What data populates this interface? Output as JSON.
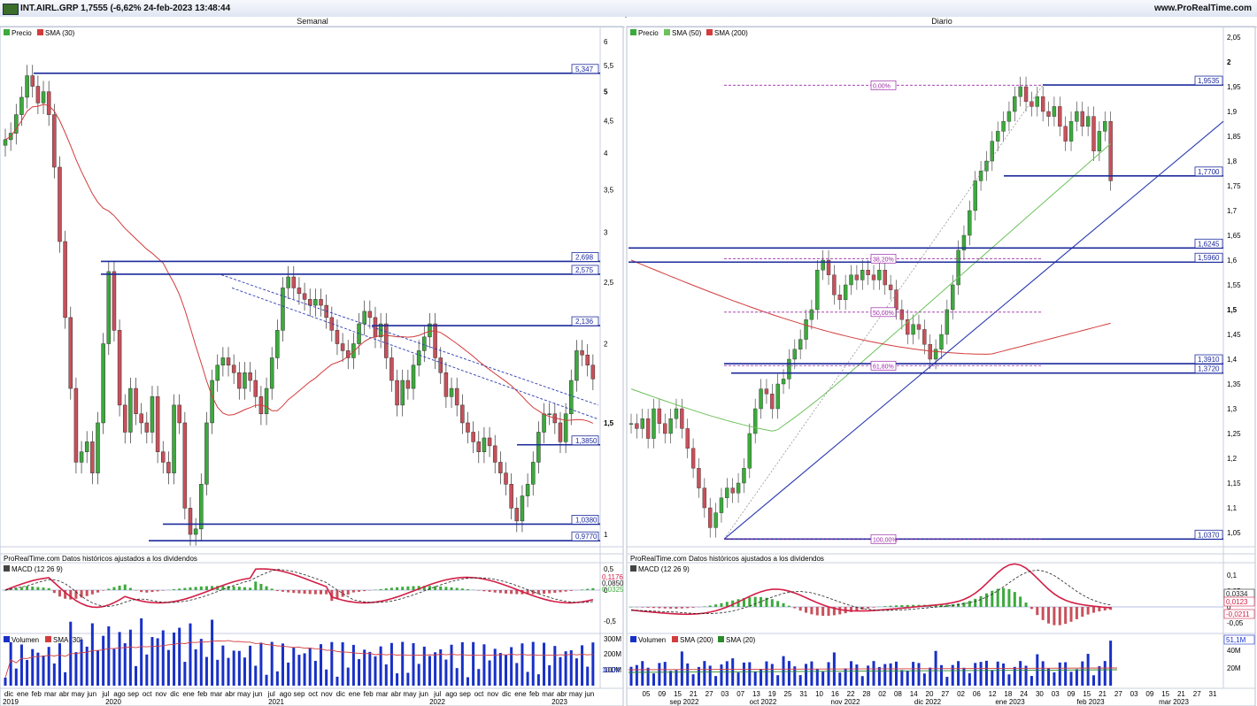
{
  "header": {
    "ticker": "INT.AIRL.GRP 1,7555 (-6,62% 24-feb-2023 13:48:44",
    "site": "www.ProRealTime.com"
  },
  "colors": {
    "up": "#3caa3c",
    "down": "#c8505a",
    "sma_red": "#d23c3c",
    "sma_green": "#6cc25a",
    "level": "#1c2a9c",
    "fib": "#9c2aa6",
    "macd": "#d21e46",
    "signal": "#222222",
    "volume": "#1830c8"
  },
  "weekly": {
    "title": "Semanal",
    "legend": {
      "price": "Precio",
      "sma": "SMA (30)"
    },
    "yticks": [
      "6",
      "5,5",
      "5",
      "4,5",
      "4",
      "3,5",
      "3",
      "2,5",
      "2",
      "1,5",
      "1"
    ],
    "levels": [
      {
        "label": "5,347",
        "value": 5.347
      },
      {
        "label": "2,698",
        "value": 2.698
      },
      {
        "label": "2,575",
        "value": 2.575
      },
      {
        "label": "2,136",
        "value": 2.136
      },
      {
        "label": "1,3850",
        "value": 1.385
      },
      {
        "label": "1,0380",
        "value": 1.038
      },
      {
        "label": "0,9770",
        "value": 0.977
      }
    ],
    "footer": "ProRealTime.com  Datos históricos ajustados a los dividendos",
    "macd": {
      "legend": "MACD (12 26 9)",
      "ticks": [
        "0,5",
        "0",
        "-0,5"
      ],
      "labels": [
        "0,1176",
        "0,0850",
        "0,0325"
      ]
    },
    "volume": {
      "legend_vol": "Volumen",
      "legend_sma": "SMA (30)",
      "ticks": [
        "300M",
        "200M",
        "100M"
      ],
      "label": "101M"
    },
    "months": [
      "dic",
      "ene",
      "feb",
      "mar",
      "abr",
      "may",
      "jun",
      "jul",
      "ago",
      "sep",
      "oct",
      "nov",
      "dic",
      "ene",
      "feb",
      "mar",
      "abr",
      "may",
      "jun",
      "jul",
      "ago",
      "sep",
      "oct",
      "nov",
      "dic",
      "ene",
      "feb",
      "mar",
      "abr",
      "may",
      "jun",
      "jul",
      "ago",
      "sep",
      "oct",
      "nov",
      "dic",
      "ene",
      "feb",
      "mar",
      "abr",
      "may",
      "jun"
    ],
    "years": [
      "2019",
      "2020",
      "2021",
      "2022",
      "2023"
    ]
  },
  "daily": {
    "title": "Diario",
    "legend": {
      "price": "Precio",
      "sma50": "SMA (50)",
      "sma200": "SMA (200)"
    },
    "yticks": [
      "2,05",
      "2",
      "1,95",
      "1,9",
      "1,85",
      "1,8",
      "1,75",
      "1,7",
      "1,65",
      "1,6",
      "1,55",
      "1,5",
      "1,45",
      "1,4",
      "1,35",
      "1,3",
      "1,25",
      "1,2",
      "1,15",
      "1,1",
      "1,05"
    ],
    "levels": [
      {
        "label": "1,9535",
        "value": 1.9535
      },
      {
        "label": "1,7700",
        "value": 1.77
      },
      {
        "label": "1,6245",
        "value": 1.6245
      },
      {
        "label": "1,5960",
        "value": 1.596
      },
      {
        "label": "1,3910",
        "value": 1.391
      },
      {
        "label": "1,3720",
        "value": 1.372
      },
      {
        "label": "1,0370",
        "value": 1.037
      }
    ],
    "fib": [
      {
        "label": "0,00%",
        "value": 1.953
      },
      {
        "label": "38,20%",
        "value": 1.603
      },
      {
        "label": "50,00%",
        "value": 1.495
      },
      {
        "label": "61,80%",
        "value": 1.387
      },
      {
        "label": "100,00%",
        "value": 1.037
      }
    ],
    "footer": "ProRealTime.com  Datos históricos ajustados a los dividendos",
    "macd": {
      "legend": "MACD (12 26 9)",
      "ticks": [
        "0,1",
        "0,05",
        "0",
        "-0,05"
      ],
      "labels": [
        "0,0334",
        "0,0123",
        "-0,0211"
      ]
    },
    "volume": {
      "legend_vol": "Volumen",
      "legend_sma200": "SMA (200)",
      "legend_sma20": "SMA (20)",
      "ticks": [
        "40M",
        "20M"
      ],
      "label": "51,1M"
    },
    "days": [
      "05",
      "09",
      "15",
      "21",
      "27",
      "03",
      "07",
      "13",
      "19",
      "25",
      "31",
      "10",
      "16",
      "22",
      "28",
      "02",
      "08",
      "14",
      "20",
      "27",
      "02",
      "06",
      "12",
      "18",
      "24",
      "30",
      "03",
      "09",
      "15",
      "21",
      "27",
      "03",
      "09",
      "15",
      "21",
      "27",
      "31"
    ],
    "months": [
      "sep 2022",
      "oct 2022",
      "nov 2022",
      "dic 2022",
      "ene 2023",
      "feb 2023",
      "mar 2023"
    ]
  },
  "chart_data": [
    {
      "type": "candlestick",
      "title": "Semanal",
      "series": [
        {
          "name": "Precio",
          "x": [
            "2019-12",
            "2020-02",
            "2020-03",
            "2020-06",
            "2020-10",
            "2020-11",
            "2021-03",
            "2021-07",
            "2021-11",
            "2022-02",
            "2022-06",
            "2022-10",
            "2023-01",
            "2023-02"
          ],
          "values": [
            4.2,
            5.3,
            2.6,
            2.65,
            1.0,
            1.4,
            2.5,
            2.35,
            2.25,
            2.15,
            1.35,
            1.05,
            1.9,
            1.76
          ]
        },
        {
          "name": "SMA (30)",
          "values": [
            3.7,
            4.1,
            4.2,
            3.0,
            1.7,
            1.5,
            1.6,
            2.0,
            2.2,
            2.0,
            1.6,
            1.3,
            1.4,
            1.53
          ]
        }
      ],
      "ylim": [
        0.95,
        6.1
      ]
    },
    {
      "type": "candlestick",
      "title": "Diario",
      "series": [
        {
          "name": "Precio",
          "x": [
            "2022-09-01",
            "2022-09-15",
            "2022-09-30",
            "2022-10-13",
            "2022-11-01",
            "2022-11-10",
            "2022-12-01",
            "2022-12-27",
            "2023-01-10",
            "2023-01-27",
            "2023-02-10",
            "2023-02-24"
          ],
          "values": [
            1.25,
            1.27,
            1.06,
            1.13,
            1.33,
            1.58,
            1.55,
            1.42,
            1.7,
            1.94,
            1.86,
            1.755
          ]
        },
        {
          "name": "SMA (50)",
          "values": [
            1.34,
            1.3,
            1.26,
            1.22,
            1.25,
            1.32,
            1.42,
            1.48,
            1.55,
            1.63,
            1.7,
            1.73
          ]
        },
        {
          "name": "SMA (200)",
          "values": [
            1.6,
            1.58,
            1.55,
            1.52,
            1.49,
            1.46,
            1.44,
            1.41,
            1.42,
            1.43,
            1.44,
            1.46
          ]
        }
      ],
      "ylim": [
        1.02,
        2.07
      ]
    }
  ]
}
